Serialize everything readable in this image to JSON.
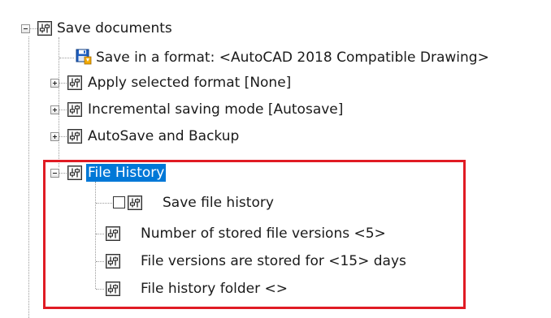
{
  "tree": {
    "root": {
      "label": "Save documents",
      "icon": "settings-icon",
      "expanded": true
    },
    "children": [
      {
        "label": "Save in a format: <AutoCAD 2018 Compatible Drawing>",
        "icon": "save-format-icon",
        "expander": "none"
      },
      {
        "label": "Apply selected format [None]",
        "icon": "settings-icon",
        "expander": "plus"
      },
      {
        "label": "Incremental saving mode [Autosave]",
        "icon": "settings-icon",
        "expander": "plus"
      },
      {
        "label": "AutoSave and Backup",
        "icon": "settings-icon",
        "expander": "plus"
      },
      {
        "label": "File History",
        "icon": "settings-icon",
        "expander": "minus",
        "selected": true,
        "children": [
          {
            "label": "Save file history",
            "icon": "settings-icon",
            "checkbox": true,
            "checked": false
          },
          {
            "label": "Number of stored file versions <5>",
            "icon": "settings-icon"
          },
          {
            "label": "File versions are stored for <15> days",
            "icon": "settings-icon"
          },
          {
            "label": "File history folder <>",
            "icon": "settings-icon"
          }
        ]
      }
    ]
  },
  "colors": {
    "selection": "#0078d7",
    "highlight_border": "#e01b24",
    "connector": "#9a9a9a"
  }
}
